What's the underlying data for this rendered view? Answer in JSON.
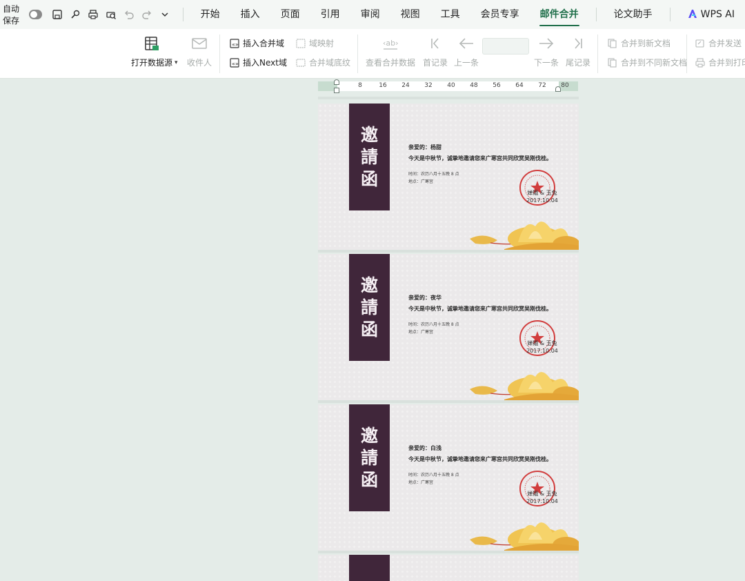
{
  "menubar": {
    "autosave_label": "自动保存",
    "quick_access": [
      "save-icon",
      "brush-icon",
      "print-icon",
      "print-preview-icon",
      "undo-icon",
      "redo-icon",
      "more-icon"
    ],
    "tabs": [
      {
        "label": "开始",
        "active": false
      },
      {
        "label": "插入",
        "active": false
      },
      {
        "label": "页面",
        "active": false
      },
      {
        "label": "引用",
        "active": false
      },
      {
        "label": "审阅",
        "active": false
      },
      {
        "label": "视图",
        "active": false
      },
      {
        "label": "工具",
        "active": false
      },
      {
        "label": "会员专享",
        "active": false
      },
      {
        "label": "邮件合并",
        "active": true
      },
      {
        "label": "论文助手",
        "active": false
      },
      {
        "label": "WPS AI",
        "active": false
      }
    ]
  },
  "ribbon": {
    "open_source": "打开数据源",
    "recipients": "收件人",
    "insert_field": "插入合并域",
    "insert_next": "插入Next域",
    "field_map": "域映射",
    "field_shading": "合并域底纹",
    "view_merged": "查看合并数据",
    "first_record": "首记录",
    "prev_record": "上一条",
    "record_value": "",
    "next_record": "下一条",
    "last_record": "尾记录",
    "merge_new_doc": "合并到新文档",
    "merge_diff_docs": "合并到不同新文档",
    "merge_send": "合并发送",
    "merge_print": "合并到打印"
  },
  "ruler": {
    "ticks": [
      "8",
      "16",
      "24",
      "32",
      "40",
      "48",
      "56",
      "64",
      "72",
      "80"
    ]
  },
  "cards": [
    {
      "title_chars": [
        "邀",
        "請",
        "函"
      ],
      "greeting": "亲爱的：杨甜",
      "message": "今天是中秋节，诚挚地邀请您来广寒宫共同欣赏吴刚伐桂。",
      "time": "时间：农历八月十五晚 8 点",
      "place": "地点：广寒宫",
      "signature": "婵娥 & 玉兔",
      "date": "2017.10.04"
    },
    {
      "title_chars": [
        "邀",
        "請",
        "函"
      ],
      "greeting": "亲爱的：夜华",
      "message": "今天是中秋节，诚挚地邀请您来广寒宫共同欣赏吴刚伐桂。",
      "time": "时间：农历八月十五晚 8 点",
      "place": "地点：广寒宫",
      "signature": "婵娥 & 玉兔",
      "date": "2017.10.04"
    },
    {
      "title_chars": [
        "邀",
        "請",
        "函"
      ],
      "greeting": "亲爱的：白浅",
      "message": "今天是中秋节，诚挚地邀请您来广寒宫共同欣赏吴刚伐桂。",
      "time": "时间：农历八月十五晚 8 点",
      "place": "地点：广寒宫",
      "signature": "婵娥 & 玉兔",
      "date": "2017.10.04"
    }
  ],
  "colors": {
    "accent": "#1f6f4a",
    "banner": "#40263a",
    "seal": "#cf2a2a",
    "background": "#e4ece8"
  }
}
